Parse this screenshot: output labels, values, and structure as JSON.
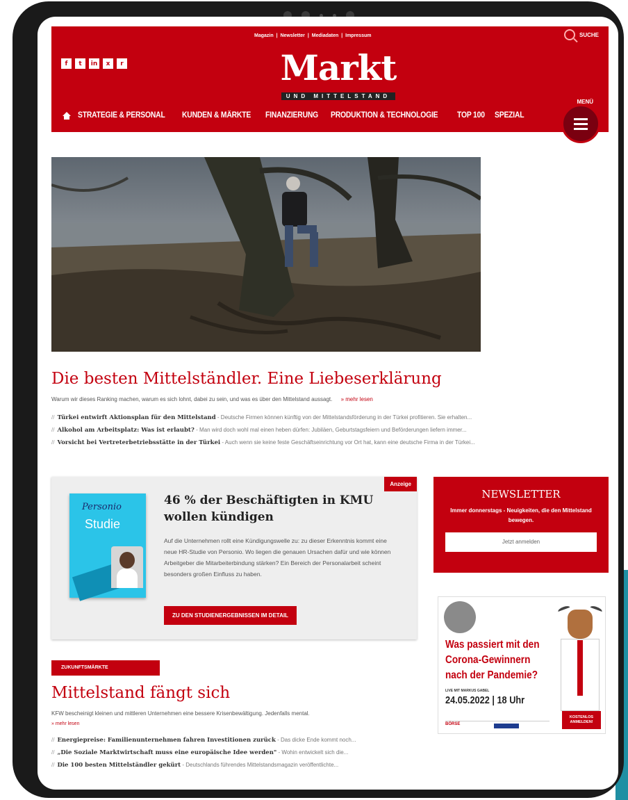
{
  "top_links": [
    "Magazin",
    "Newsletter",
    "Mediadaten",
    "Impressum"
  ],
  "search_label": "SUCHE",
  "social_icons": [
    {
      "name": "facebook-icon",
      "glyph": "f"
    },
    {
      "name": "twitter-icon",
      "glyph": "t"
    },
    {
      "name": "linkedin-icon",
      "glyph": "in"
    },
    {
      "name": "xing-icon",
      "glyph": "x"
    },
    {
      "name": "rss-icon",
      "glyph": "r"
    }
  ],
  "logo": {
    "word": "Markt",
    "sub": "UND MITTELSTAND"
  },
  "menu_label": "MENÜ",
  "nav": [
    "STRATEGIE & PERSONAL",
    "KUNDEN & MÄRKTE",
    "FINANZIERUNG",
    "PRODUKTION & TECHNOLOGIE",
    "TOP 100",
    "SPEZIAL"
  ],
  "lead": {
    "headline": "Die besten Mittelständler. Eine Liebeserklärung",
    "teaser": "Warum wir dieses Ranking machen, warum es sich lohnt, dabei zu sein, und was es über den Mittelstand aussagt.",
    "more": "» mehr lesen",
    "related": [
      {
        "title": "Türkei entwirft Aktionsplan für den Mittelstand",
        "text": " - Deutsche Firmen können künftig von der Mittelstandsförderung in der Türkei profitieren. Sie erhalten..."
      },
      {
        "title": "Alkohol am Arbeitsplatz: Was ist erlaubt?",
        "text": " - Man wird doch wohl mal einen heben dürfen: Jubiläen, Geburtstagsfeiern und Beförderungen liefern immer..."
      },
      {
        "title": "Vorsicht bei Vertreterbetriebsstätte in der Türkei",
        "text": " - Auch wenn sie keine feste Geschäftseinrichtung vor Ort hat, kann eine deutsche Firma in der Türkei..."
      }
    ]
  },
  "ad": {
    "badge": "Anzeige",
    "book_brand": "Personio",
    "book_word": "Studie",
    "title": "46 % der Beschäftigten in KMU wollen kündigen",
    "body": "Auf die Unternehmen rollt eine Kündigungswelle zu: zu dieser Erkenntnis kommt eine neue HR-Studie von Personio. Wo liegen die genauen Ursachen dafür und wie können Arbeitgeber die Mitarbeiterbindung stärken? Ein Bereich der Personalarbeit scheint besonders großen Einfluss zu haben.",
    "cta": "ZU DEN STUDIENERGEBNISSEN IM DETAIL"
  },
  "newsletter": {
    "title": "NEWSLETTER",
    "text": "Immer donnerstags - Neuigkeiten, die den Mittelstand bewegen.",
    "button": "Jetzt anmelden"
  },
  "side_ad": {
    "headline": "Was passiert mit den Corona-Gewinnern nach der Pandemie?",
    "small": "LIVE MIT MARKUS GABEL",
    "date": "24.05.2022 | 18 Uhr",
    "brand": "BÖRSE",
    "button": "KOSTENLOS ANMELDEN!"
  },
  "section2": {
    "category": "ZUKUNFTSMÄRKTE",
    "headline": "Mittelstand fängt sich",
    "teaser": "KFW bescheinigt kleinen und mittleren Unternehmen eine bessere Krisenbewältigung. Jedenfalls mental.",
    "more": "» mehr lesen",
    "related": [
      {
        "title": "Energiepreise: Familienunternehmen fahren Investitionen zurück",
        "text": " - Das dicke Ende kommt noch..."
      },
      {
        "title": "„Die Soziale Marktwirtschaft muss eine europäische Idee werden\"",
        "text": " - Wohin entwickelt sich die..."
      },
      {
        "title": "Die 100 besten Mittelständler gekürt",
        "text": " - Deutschlands führendes Mittelstandsmagazin veröffentlichte..."
      }
    ]
  }
}
